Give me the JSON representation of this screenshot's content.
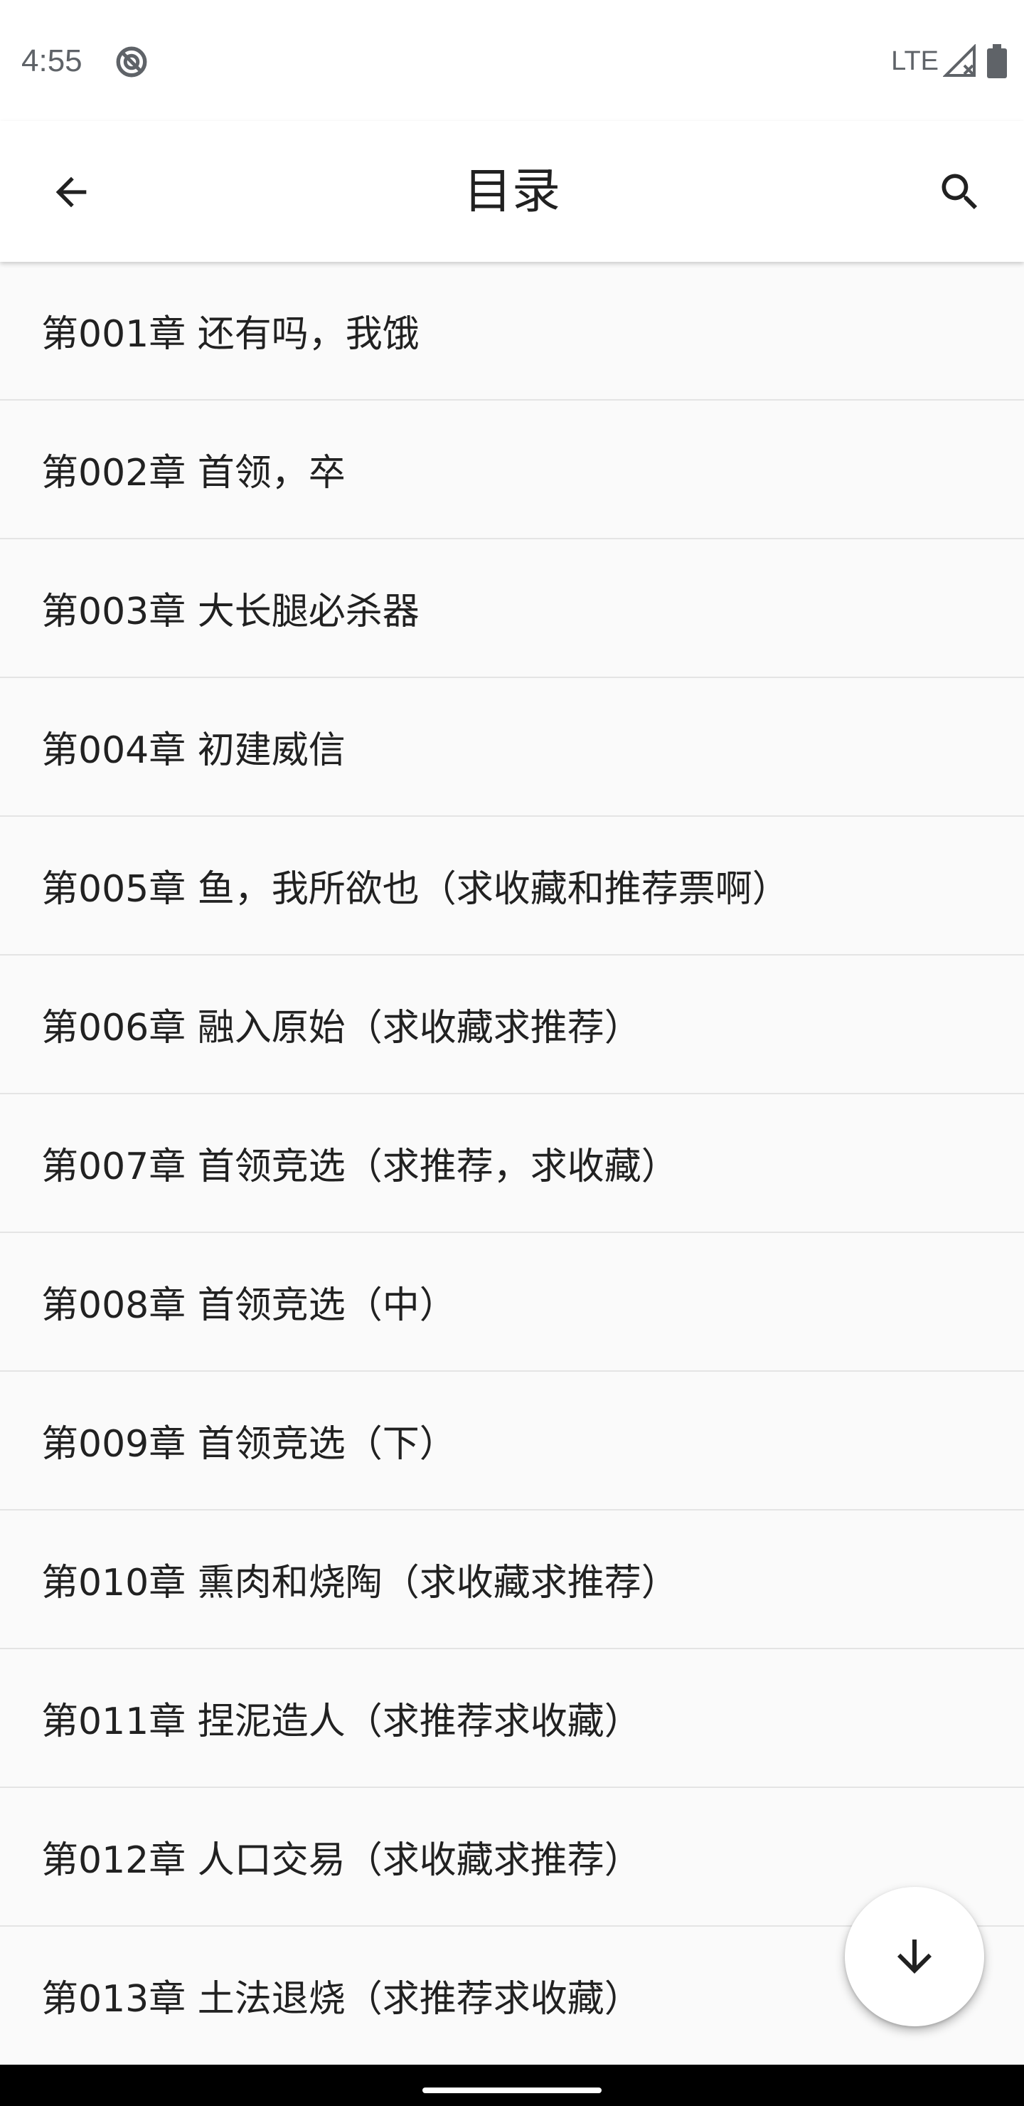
{
  "status_bar": {
    "time": "4:55",
    "network": "LTE",
    "icons": [
      "do-not-disturb-icon",
      "signal-icon",
      "battery-icon"
    ]
  },
  "app_bar": {
    "title": "目录",
    "back_icon": "arrow-back-icon",
    "search_icon": "search-icon"
  },
  "chapters": [
    {
      "title": "第001章 还有吗，我饿"
    },
    {
      "title": "第002章 首领，卒"
    },
    {
      "title": "第003章 大长腿必杀器"
    },
    {
      "title": "第004章 初建威信"
    },
    {
      "title": "第005章 鱼，我所欲也（求收藏和推荐票啊）"
    },
    {
      "title": "第006章 融入原始（求收藏求推荐）"
    },
    {
      "title": "第007章 首领竞选（求推荐，求收藏）"
    },
    {
      "title": "第008章 首领竞选（中）"
    },
    {
      "title": "第009章 首领竞选（下）"
    },
    {
      "title": "第010章 熏肉和烧陶（求收藏求推荐）"
    },
    {
      "title": "第011章 捏泥造人（求推荐求收藏）"
    },
    {
      "title": "第012章 人口交易（求收藏求推荐）"
    },
    {
      "title": "第013章 土法退烧（求推荐求收藏）"
    }
  ],
  "fab": {
    "icon": "arrow-down-icon"
  },
  "colors": {
    "background": "#fafafa",
    "app_bar": "#ffffff",
    "text": "#212121",
    "divider": "#e4e4e4",
    "status_icons": "#5f6368"
  }
}
